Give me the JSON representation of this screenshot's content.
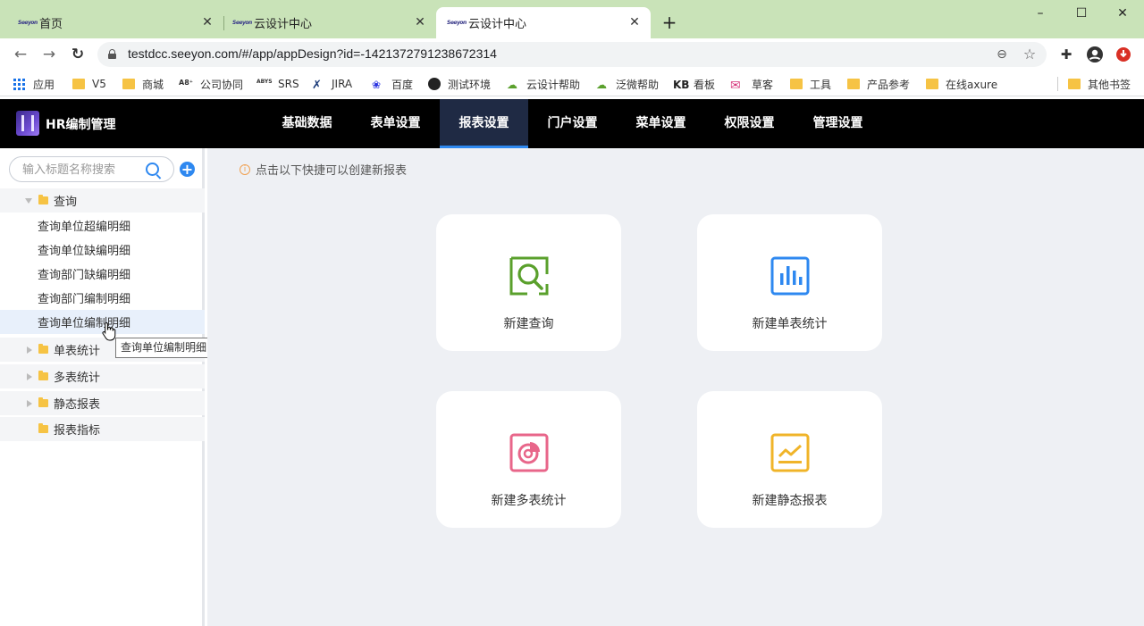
{
  "browser": {
    "tabs": [
      {
        "title": "首页",
        "active": false
      },
      {
        "title": "云设计中心",
        "active": false
      },
      {
        "title": "云设计中心",
        "active": true
      }
    ],
    "new_tab": "+",
    "window_controls": [
      "–",
      "☐",
      "✕"
    ],
    "url": "testdcc.seeyon.com/#/app/appDesign?id=-1421372791238672314",
    "bookmarks": [
      {
        "label": "应用",
        "icon": "apps-icon"
      },
      {
        "label": "V5",
        "icon": "folder-icon"
      },
      {
        "label": "商城",
        "icon": "folder-icon"
      },
      {
        "label": "公司协同",
        "icon": "a8-icon"
      },
      {
        "label": "SRS",
        "icon": "abys-icon"
      },
      {
        "label": "JIRA",
        "icon": "jira-icon"
      },
      {
        "label": "百度",
        "icon": "baidu-icon"
      },
      {
        "label": "测试环境",
        "icon": "globe-icon"
      },
      {
        "label": "云设计帮助",
        "icon": "help-icon"
      },
      {
        "label": "泛微帮助",
        "icon": "help-icon"
      },
      {
        "label": "看板",
        "icon": "kb-icon"
      },
      {
        "label": "草客",
        "icon": "mail-icon"
      },
      {
        "label": "工具",
        "icon": "folder-icon"
      },
      {
        "label": "产品参考",
        "icon": "folder-icon"
      },
      {
        "label": "在线axure",
        "icon": "folder-icon"
      }
    ],
    "other_bookmarks": "其他书签"
  },
  "app": {
    "title": "HR编制管理",
    "menu": [
      {
        "label": "基础数据",
        "active": false
      },
      {
        "label": "表单设置",
        "active": false
      },
      {
        "label": "报表设置",
        "active": true
      },
      {
        "label": "门户设置",
        "active": false
      },
      {
        "label": "菜单设置",
        "active": false
      },
      {
        "label": "权限设置",
        "active": false
      },
      {
        "label": "管理设置",
        "active": false
      }
    ],
    "accent_color": "#2e88f0"
  },
  "sidebar": {
    "search_placeholder": "输入标题名称搜索",
    "add_label": "+",
    "tree": {
      "query_group": "查询",
      "query_items": [
        "查询单位超编明细",
        "查询单位缺编明细",
        "查询部门缺编明细",
        "查询部门编制明细",
        "查询单位编制明细"
      ],
      "single_stats": "单表统计",
      "multi_stats": "多表统计",
      "static_report": "静态报表",
      "report_index": "报表指标"
    },
    "tooltip": "查询单位编制明细"
  },
  "main": {
    "hint": "点击以下快捷可以创建新报表",
    "hint_icon": "i",
    "cards": [
      {
        "label": "新建查询",
        "icon": "search-report-icon",
        "color": "#5aa02c"
      },
      {
        "label": "新建单表统计",
        "icon": "bar-chart-icon",
        "color": "#2e88f0"
      },
      {
        "label": "新建多表统计",
        "icon": "pie-chart-icon",
        "color": "#e8668a"
      },
      {
        "label": "新建静态报表",
        "icon": "line-chart-icon",
        "color": "#f0b429"
      }
    ]
  }
}
